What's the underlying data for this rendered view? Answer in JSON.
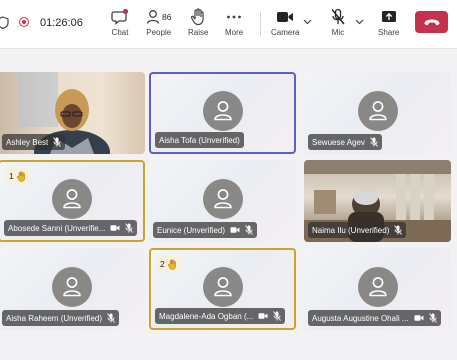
{
  "toolbar": {
    "timer": "01:26:06",
    "chat_label": "Chat",
    "people_label": "People",
    "people_count": "86",
    "raise_label": "Raise",
    "more_label": "More",
    "camera_label": "Camera",
    "mic_label": "Mic",
    "share_label": "Share",
    "leave_color": "#c4314b"
  },
  "participants": [
    {
      "name": "Ashley Best",
      "muted": true,
      "video": true
    },
    {
      "name": "Aisha Tofa (Unverified)",
      "muted": false,
      "video": false,
      "active_speaker": true
    },
    {
      "name": "Sewuese Agev",
      "muted": true,
      "video": false
    },
    {
      "name": "Abosede Sanni (Unverifie...",
      "muted": true,
      "video": false,
      "hand_raised": true,
      "hand_order": "1"
    },
    {
      "name": "Eunice (Unverified)",
      "muted": true,
      "video": false
    },
    {
      "name": "Naima Ilu (Unverified)",
      "muted": true,
      "video": true
    },
    {
      "name": "Aisha Raheem (Unverified)",
      "muted": true,
      "video": false
    },
    {
      "name": "Magdalene-Ada Ogban (...",
      "muted": true,
      "video": false,
      "hand_raised": true,
      "hand_order": "2"
    },
    {
      "name": "Augusta Augustine Ohali ...",
      "muted": true,
      "video": false
    }
  ]
}
